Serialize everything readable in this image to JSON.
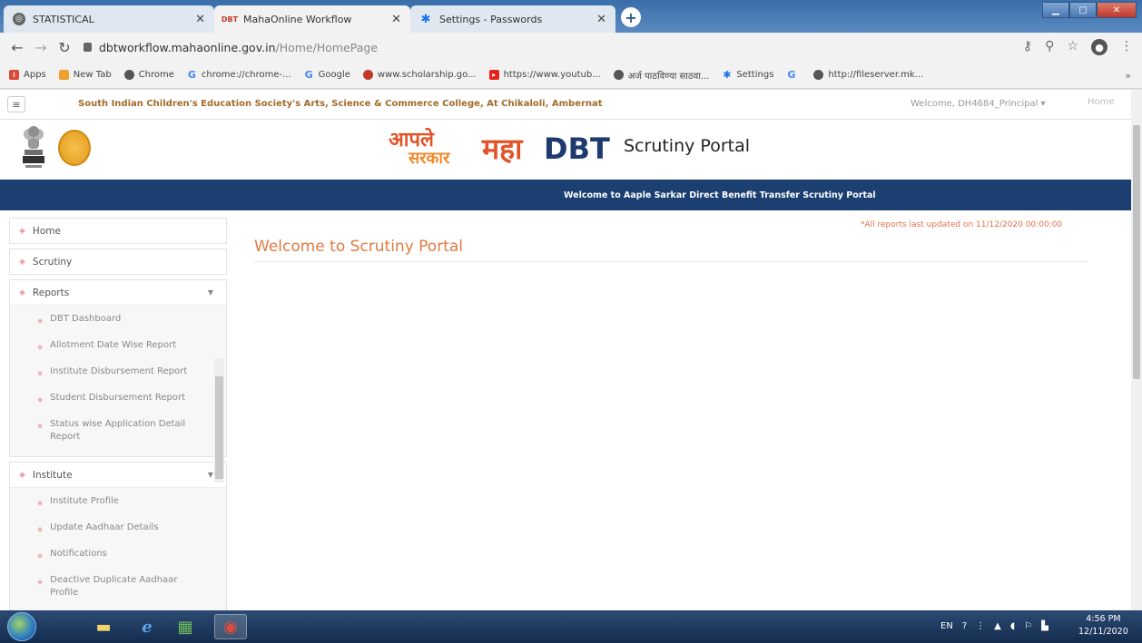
{
  "browser": {
    "tabs": [
      {
        "title": "STATISTICAL",
        "icon": "globe-icon"
      },
      {
        "title": "MahaOnline Workflow",
        "icon": "dbt-favicon-icon"
      },
      {
        "title": "Settings - Passwords",
        "icon": "gear-icon"
      }
    ],
    "url": {
      "domain": "dbtworkflow.mahaonline.gov.in",
      "path": "/Home/HomePage"
    },
    "bookmarks": [
      {
        "label": "Apps",
        "color": "#d94a38"
      },
      {
        "label": "New Tab",
        "color": "#f0a030"
      },
      {
        "label": "Chrome",
        "color": "#555555"
      },
      {
        "label": "chrome://chrome-...",
        "color": "#4285f4"
      },
      {
        "label": "Google",
        "color": "#4285f4"
      },
      {
        "label": "www.scholarship.go...",
        "color": "#c0392b"
      },
      {
        "label": "https://www.youtub...",
        "color": "#e62117"
      },
      {
        "label": "अर्ज पाठविण्या साठवा...",
        "color": "#555555"
      },
      {
        "label": "Settings",
        "color": "#1a73e8"
      },
      {
        "label": "",
        "color": "#4285f4"
      },
      {
        "label": "http://fileserver.mk...",
        "color": "#555555"
      }
    ],
    "bookmarks_more": "»"
  },
  "header": {
    "college": "South Indian Children's Education Society's Arts, Science & Commerce College, At Chikaloli, Ambernat",
    "welcome_user": "Welcome, DH4684_Principal ▾",
    "home_link": "Home",
    "logo_aaple_line1": "आपले",
    "logo_aaple_line2": "सरकार",
    "logo_maha": "महा",
    "logo_dbt": "DBT",
    "portal_title": "Scrutiny Portal",
    "banner": "Welcome to Aaple Sarkar Direct Benefit Transfer Scrutiny Portal"
  },
  "sidebar": {
    "home": "Home",
    "scrutiny": "Scrutiny",
    "reports": {
      "label": "Reports",
      "items": [
        "DBT Dashboard",
        "Allotment Date Wise Report",
        "Institute Disbursement Report",
        "Student Disbursement Report",
        "Status wise Application Detail Report"
      ]
    },
    "institute": {
      "label": "Institute",
      "items": [
        "Institute Profile",
        "Update Aadhaar Details",
        "Notifications",
        "Deactive Duplicate Aadhaar Profile"
      ]
    }
  },
  "main": {
    "updated_note": "*All reports last updated on 11/12/2020 00:00:00",
    "heading": "Welcome to Scrutiny Portal"
  },
  "taskbar": {
    "lang": "EN",
    "time": "4:56 PM",
    "date": "12/11/2020"
  },
  "colors": {
    "accent_orange": "#e17a41",
    "navy_banner": "#1c3f72",
    "college_brown": "#a36a2a"
  }
}
